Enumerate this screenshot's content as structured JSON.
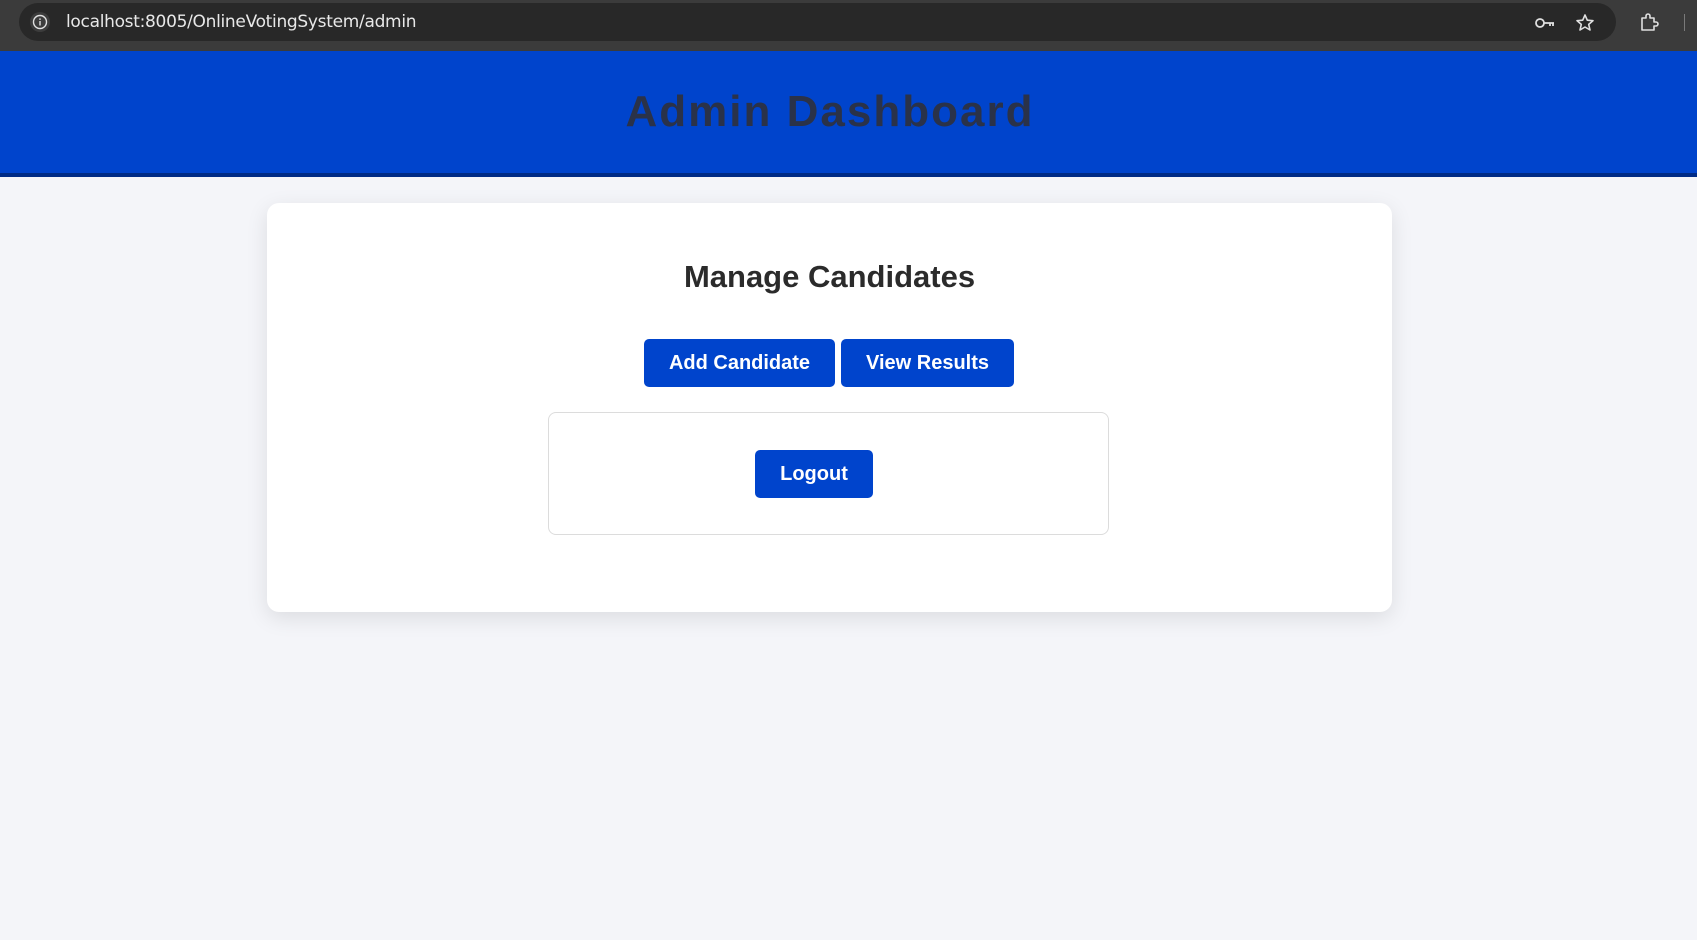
{
  "browser": {
    "url": "localhost:8005/OnlineVotingSystem/admin",
    "icons": [
      "info-icon",
      "key-icon",
      "star-icon",
      "extensions-icon"
    ]
  },
  "header": {
    "title": "Admin Dashboard"
  },
  "main": {
    "title": "Manage Candidates",
    "add_candidate_label": "Add Candidate",
    "view_results_label": "View Results",
    "logout_label": "Logout"
  },
  "colors": {
    "accent": "#0044cc",
    "header_border": "#002b86",
    "page_background": "#f4f5f9",
    "title_text": "#2a3249"
  }
}
